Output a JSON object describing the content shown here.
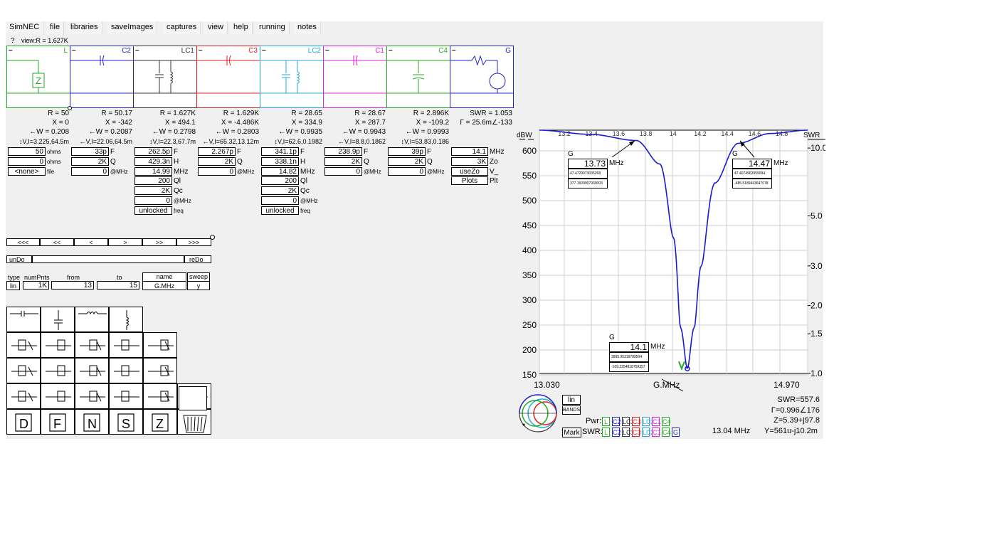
{
  "menu": [
    "SimNEC",
    "file",
    "libraries",
    "saveImages",
    "captures",
    "view",
    "help",
    "running",
    "notes"
  ],
  "status": {
    "help": "?",
    "view": "view:R = 1.627K"
  },
  "cells": [
    {
      "label": "L",
      "color": "#22aa22"
    },
    {
      "label": "C2",
      "color": "#2222cc"
    },
    {
      "label": "LC1",
      "color": "#333333"
    },
    {
      "label": "C3",
      "color": "#dd2222"
    },
    {
      "label": "LC2",
      "color": "#22aadd"
    },
    {
      "label": "C1",
      "color": "#dd22dd"
    },
    {
      "label": "C4",
      "color": "#22aa22"
    },
    {
      "label": "G",
      "color": "#2222cc"
    }
  ],
  "readouts": [
    {
      "r": "R = 50",
      "x": "X = 0",
      "w": "←W = 0.208",
      "v": "↕V,I=3.225,64.5m"
    },
    {
      "r": "R = 50.17",
      "x": "X = -342",
      "w": "←W = 0.2087",
      "v": "←V,I=22.06,64.5m"
    },
    {
      "r": "R = 1.627K",
      "x": "X = 494.1",
      "w": "←W = 0.2798",
      "v": "↕V,I=22.3,67.7m"
    },
    {
      "r": "R = 1.629K",
      "x": "X = -4.486K",
      "w": "←W = 0.2803",
      "v": "←V,I=65.32,13.12m"
    },
    {
      "r": "R = 28.65",
      "x": "X = 334.9",
      "w": "←W = 0.9935",
      "v": "↕V,I=62.6,0.1982"
    },
    {
      "r": "R = 28.67",
      "x": "X = 287.7",
      "w": "←W = 0.9943",
      "v": "←V,I=8.8,0.1862"
    },
    {
      "r": "R = 2.896K",
      "x": "X = -109.2",
      "w": "←W = 0.9993",
      "v": "↕V,I=53.83,0.186"
    },
    {
      "r": "SWR = 1.053",
      "x": "Γ = 25.6m∠-133",
      "w": "",
      "v": ""
    }
  ],
  "params": {
    "L": [
      [
        "50",
        "ohms"
      ],
      [
        "0",
        "ohms"
      ],
      [
        "<none>",
        "file"
      ]
    ],
    "C2": [
      [
        "33p",
        "F"
      ],
      [
        "2K",
        "Q"
      ],
      [
        "0",
        "@MHz"
      ]
    ],
    "LC1": [
      [
        "262.5p",
        "F"
      ],
      [
        "429.3n",
        "H"
      ],
      [
        "14.99",
        "MHz"
      ],
      [
        "200",
        "Ql"
      ],
      [
        "2K",
        "Qc"
      ],
      [
        "0",
        "@MHz"
      ],
      [
        "unlocked",
        "freq"
      ]
    ],
    "C3": [
      [
        "2.267p",
        "F"
      ],
      [
        "2K",
        "Q"
      ],
      [
        "0",
        "@MHz"
      ]
    ],
    "LC2": [
      [
        "341.1p",
        "F"
      ],
      [
        "338.1n",
        "H"
      ],
      [
        "14.82",
        "MHz"
      ],
      [
        "200",
        "Ql"
      ],
      [
        "2K",
        "Qc"
      ],
      [
        "0",
        "@MHz"
      ],
      [
        "unlocked",
        "freq"
      ]
    ],
    "C1": [
      [
        "238.9p",
        "F"
      ],
      [
        "2K",
        "Q"
      ],
      [
        "0",
        "@MHz"
      ]
    ],
    "C4": [
      [
        "39p",
        "F"
      ],
      [
        "2K",
        "Q"
      ],
      [
        "0",
        "@MHz"
      ]
    ],
    "G": [
      [
        "14.1",
        "MHz"
      ],
      [
        "3K",
        "Zo"
      ],
      [
        "useZo",
        "V_"
      ],
      [
        "Plots",
        "Plt"
      ]
    ]
  },
  "nav": [
    "<<<",
    "<<",
    "<",
    ">",
    ">>",
    ">>>"
  ],
  "undo": "unDo",
  "redo": "reDo",
  "sweep": {
    "h_type": "type",
    "h_num": "numPnts",
    "h_from": "from",
    "h_to": "to",
    "h_name": "name",
    "h_sweep": "sweep",
    "type": "lin",
    "num": "1K",
    "from": "13",
    "to": "15",
    "name": "G.MHz",
    "sweep": "y"
  },
  "plot": {
    "left_unit": "dBW",
    "right_unit": "SWR",
    "top_ticks": [
      "13.2",
      "13.4",
      "13.6",
      "13.8",
      "14",
      "14.2",
      "14.4",
      "14.6",
      "14.8"
    ],
    "left_ticks": [
      "600",
      "550",
      "500",
      "450",
      "400",
      "350",
      "300",
      "250",
      "200",
      "150"
    ],
    "right_ticks": [
      "10.0",
      "5.0",
      "3.0",
      "2.0",
      "1.5",
      "1.0"
    ],
    "x_min": "13.030",
    "x_max": "14.970",
    "x_name": "G.MHz",
    "markers": [
      {
        "g": "G",
        "freq": "13.73",
        "unit": "MHz",
        "r": "47.4729073035268",
        "x": "377.1509907930003"
      },
      {
        "g": "G",
        "freq": "14.47",
        "unit": "MHz",
        "r": "47.4074963959094",
        "x": "-485.5189443647078"
      },
      {
        "g": "G",
        "freq": "14.1",
        "unit": "MHz",
        "r": "2895.95319789504",
        "x": "-109.2254818759357"
      }
    ]
  },
  "chart_data": {
    "type": "line",
    "x_label": "G.MHz",
    "xlim": [
      13.03,
      14.97
    ],
    "series": [
      {
        "x": [
          13.03,
          13.4,
          13.73,
          13.9,
          14.0,
          14.05,
          14.1,
          14.15,
          14.2,
          14.3,
          14.47,
          14.7,
          14.97
        ],
        "swr": [
          12,
          11.5,
          10.8,
          8.5,
          4.0,
          1.6,
          1.05,
          1.6,
          3.0,
          7.0,
          10.5,
          11.6,
          12
        ]
      }
    ]
  },
  "bottom": {
    "lin": "lin",
    "bands": "BANDS",
    "mark": "Mark",
    "pwr": "Pwr:",
    "swr_label": "SWR:",
    "pwr_items": [
      "L",
      "C2",
      "LC1",
      "C3",
      "LC2",
      "C1",
      "C4"
    ],
    "swr_items": [
      "L",
      "C2",
      "LC1",
      "C3",
      "LC2",
      "C1",
      "C4",
      "G"
    ],
    "swr": "SWR=557.6",
    "gamma": "Γ=0.996∠176",
    "z": "Z=5.39+j97.8",
    "freq": "13.04 MHz",
    "y": "Y=561u-j10.2m"
  }
}
